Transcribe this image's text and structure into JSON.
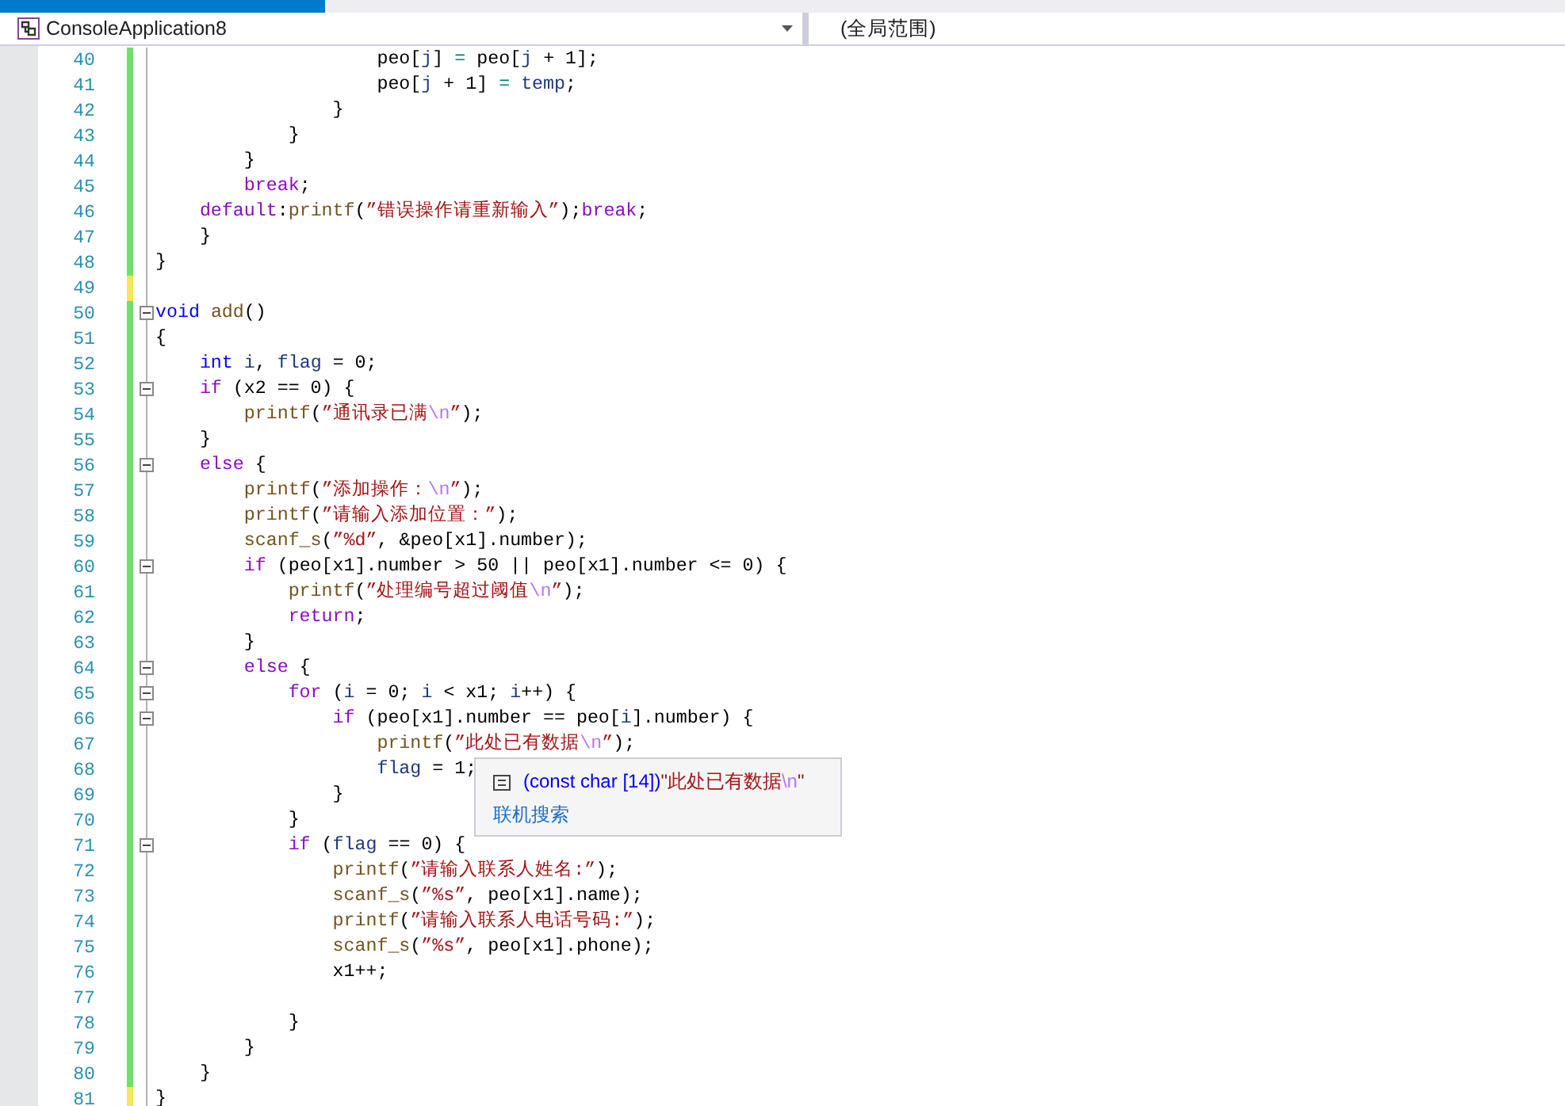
{
  "tab": {
    "shown": true
  },
  "navigation_bar": {
    "project": "ConsoleApplication8",
    "scope": "(全局范围)"
  },
  "editor": {
    "lines": [
      {
        "number": "40",
        "saved": true,
        "foldable": false,
        "tokens": [
          {
            "kind": "plain",
            "text": "                    peo["
          },
          {
            "kind": "variable",
            "text": "j"
          },
          {
            "kind": "plain",
            "text": "] "
          },
          {
            "kind": "operator",
            "text": "="
          },
          {
            "kind": "plain",
            "text": " peo["
          },
          {
            "kind": "variable",
            "text": "j"
          },
          {
            "kind": "plain",
            "text": " + 1];"
          }
        ]
      },
      {
        "number": "41",
        "saved": true,
        "foldable": false,
        "tokens": [
          {
            "kind": "plain",
            "text": "                    peo["
          },
          {
            "kind": "variable",
            "text": "j"
          },
          {
            "kind": "plain",
            "text": " + 1] "
          },
          {
            "kind": "operator",
            "text": "="
          },
          {
            "kind": "variable",
            "text": " temp"
          },
          {
            "kind": "plain",
            "text": ";"
          }
        ]
      },
      {
        "number": "42",
        "saved": true,
        "foldable": false,
        "tokens": [
          {
            "kind": "plain",
            "text": "                }"
          }
        ]
      },
      {
        "number": "43",
        "saved": true,
        "foldable": false,
        "tokens": [
          {
            "kind": "plain",
            "text": "            }"
          }
        ]
      },
      {
        "number": "44",
        "saved": true,
        "foldable": false,
        "tokens": [
          {
            "kind": "plain",
            "text": "        }"
          }
        ]
      },
      {
        "number": "45",
        "saved": true,
        "foldable": false,
        "tokens": [
          {
            "kind": "control",
            "text": "        break"
          },
          {
            "kind": "plain",
            "text": ";"
          }
        ]
      },
      {
        "number": "46",
        "saved": true,
        "foldable": false,
        "tokens": [
          {
            "kind": "control",
            "text": "    default"
          },
          {
            "kind": "plain",
            "text": ":"
          },
          {
            "kind": "function",
            "text": "printf"
          },
          {
            "kind": "plain",
            "text": "("
          },
          {
            "kind": "string",
            "text": "”错误操作请重新输入”"
          },
          {
            "kind": "plain",
            "text": ");"
          },
          {
            "kind": "control",
            "text": "break"
          },
          {
            "kind": "plain",
            "text": ";"
          }
        ]
      },
      {
        "number": "47",
        "saved": true,
        "foldable": false,
        "tokens": [
          {
            "kind": "plain",
            "text": "    }"
          }
        ]
      },
      {
        "number": "48",
        "saved": true,
        "foldable": false,
        "tokens": [
          {
            "kind": "plain",
            "text": "}"
          }
        ]
      },
      {
        "number": "49",
        "saved": false,
        "foldable": false
      },
      {
        "number": "50",
        "saved": true,
        "foldable": true,
        "tokens": [
          {
            "kind": "keyword",
            "text": "void"
          },
          {
            "kind": "function",
            "text": " add"
          },
          {
            "kind": "plain",
            "text": "()"
          }
        ]
      },
      {
        "number": "51",
        "saved": true,
        "foldable": false,
        "tokens": [
          {
            "kind": "plain",
            "text": "{"
          }
        ]
      },
      {
        "number": "52",
        "saved": true,
        "foldable": false,
        "tokens": [
          {
            "kind": "keyword",
            "text": "    int"
          },
          {
            "kind": "variable",
            "text": " i"
          },
          {
            "kind": "plain",
            "text": ", "
          },
          {
            "kind": "variable",
            "text": "flag"
          },
          {
            "kind": "plain",
            "text": " = 0;"
          }
        ]
      },
      {
        "number": "53",
        "saved": true,
        "foldable": true,
        "tokens": [
          {
            "kind": "control",
            "text": "    if"
          },
          {
            "kind": "plain",
            "text": " (x2 == 0) {"
          }
        ]
      },
      {
        "number": "54",
        "saved": true,
        "foldable": false,
        "tokens": [
          {
            "kind": "function",
            "text": "        printf"
          },
          {
            "kind": "plain",
            "text": "("
          },
          {
            "kind": "string",
            "text": "”通讯录已满"
          },
          {
            "kind": "escape",
            "text": "\\n"
          },
          {
            "kind": "string",
            "text": "”"
          },
          {
            "kind": "plain",
            "text": ");"
          }
        ]
      },
      {
        "number": "55",
        "saved": true,
        "foldable": false,
        "tokens": [
          {
            "kind": "plain",
            "text": "    }"
          }
        ]
      },
      {
        "number": "56",
        "saved": true,
        "foldable": true,
        "tokens": [
          {
            "kind": "control",
            "text": "    else"
          },
          {
            "kind": "plain",
            "text": " {"
          }
        ]
      },
      {
        "number": "57",
        "saved": true,
        "foldable": false,
        "tokens": [
          {
            "kind": "function",
            "text": "        printf"
          },
          {
            "kind": "plain",
            "text": "("
          },
          {
            "kind": "string",
            "text": "”添加操作："
          },
          {
            "kind": "escape",
            "text": "\\n"
          },
          {
            "kind": "string",
            "text": "”"
          },
          {
            "kind": "plain",
            "text": ");"
          }
        ]
      },
      {
        "number": "58",
        "saved": true,
        "foldable": false,
        "tokens": [
          {
            "kind": "function",
            "text": "        printf"
          },
          {
            "kind": "plain",
            "text": "("
          },
          {
            "kind": "string",
            "text": "”请输入添加位置：”"
          },
          {
            "kind": "plain",
            "text": ");"
          }
        ]
      },
      {
        "number": "59",
        "saved": true,
        "foldable": false,
        "tokens": [
          {
            "kind": "function",
            "text": "        scanf_s"
          },
          {
            "kind": "plain",
            "text": "("
          },
          {
            "kind": "string",
            "text": "”%d”"
          },
          {
            "kind": "plain",
            "text": ", &peo[x1].number);"
          }
        ]
      },
      {
        "number": "60",
        "saved": true,
        "foldable": true,
        "tokens": [
          {
            "kind": "control",
            "text": "        if"
          },
          {
            "kind": "plain",
            "text": " (peo[x1].number > 50 || peo[x1].number <= 0) {"
          }
        ]
      },
      {
        "number": "61",
        "saved": true,
        "foldable": false,
        "tokens": [
          {
            "kind": "function",
            "text": "            printf"
          },
          {
            "kind": "plain",
            "text": "("
          },
          {
            "kind": "string",
            "text": "”处理编号超过阈值"
          },
          {
            "kind": "escape",
            "text": "\\n"
          },
          {
            "kind": "string",
            "text": "”"
          },
          {
            "kind": "plain",
            "text": ");"
          }
        ]
      },
      {
        "number": "62",
        "saved": true,
        "foldable": false,
        "tokens": [
          {
            "kind": "control",
            "text": "            return"
          },
          {
            "kind": "plain",
            "text": ";"
          }
        ]
      },
      {
        "number": "63",
        "saved": true,
        "foldable": false,
        "tokens": [
          {
            "kind": "plain",
            "text": "        }"
          }
        ]
      },
      {
        "number": "64",
        "saved": true,
        "foldable": true,
        "tokens": [
          {
            "kind": "control",
            "text": "        else"
          },
          {
            "kind": "plain",
            "text": " {"
          }
        ]
      },
      {
        "number": "65",
        "saved": true,
        "foldable": true,
        "tokens": [
          {
            "kind": "control",
            "text": "            for"
          },
          {
            "kind": "plain",
            "text": " ("
          },
          {
            "kind": "variable",
            "text": "i"
          },
          {
            "kind": "plain",
            "text": " = 0; "
          },
          {
            "kind": "variable",
            "text": "i"
          },
          {
            "kind": "plain",
            "text": " < x1; "
          },
          {
            "kind": "variable",
            "text": "i"
          },
          {
            "kind": "plain",
            "text": "++) {"
          }
        ]
      },
      {
        "number": "66",
        "saved": true,
        "foldable": true,
        "tokens": [
          {
            "kind": "control",
            "text": "                if"
          },
          {
            "kind": "plain",
            "text": " (peo[x1].number == peo["
          },
          {
            "kind": "variable",
            "text": "i"
          },
          {
            "kind": "plain",
            "text": "].number) {"
          }
        ]
      },
      {
        "number": "67",
        "saved": true,
        "foldable": false,
        "tokens": [
          {
            "kind": "function",
            "text": "                    printf"
          },
          {
            "kind": "plain",
            "text": "("
          },
          {
            "kind": "string",
            "text": "”此处已有数据"
          },
          {
            "kind": "escape",
            "text": "\\n"
          },
          {
            "kind": "string",
            "text": "”"
          },
          {
            "kind": "plain",
            "text": ");"
          }
        ]
      },
      {
        "number": "68",
        "saved": true,
        "foldable": false,
        "tokens": [
          {
            "kind": "variable",
            "text": "                    flag"
          },
          {
            "kind": "plain",
            "text": " = 1;"
          }
        ]
      },
      {
        "number": "69",
        "saved": true,
        "foldable": false,
        "tokens": [
          {
            "kind": "plain",
            "text": "                }"
          }
        ]
      },
      {
        "number": "70",
        "saved": true,
        "foldable": false,
        "tokens": [
          {
            "kind": "plain",
            "text": "            }"
          }
        ]
      },
      {
        "number": "71",
        "saved": true,
        "foldable": true,
        "tokens": [
          {
            "kind": "control",
            "text": "            if"
          },
          {
            "kind": "plain",
            "text": " ("
          },
          {
            "kind": "variable",
            "text": "flag"
          },
          {
            "kind": "plain",
            "text": " == 0) {"
          }
        ]
      },
      {
        "number": "72",
        "saved": true,
        "foldable": false,
        "tokens": [
          {
            "kind": "function",
            "text": "                printf"
          },
          {
            "kind": "plain",
            "text": "("
          },
          {
            "kind": "string",
            "text": "”请输入联系人姓名:”"
          },
          {
            "kind": "plain",
            "text": ");"
          }
        ]
      },
      {
        "number": "73",
        "saved": true,
        "foldable": false,
        "tokens": [
          {
            "kind": "function",
            "text": "                scanf_s"
          },
          {
            "kind": "plain",
            "text": "("
          },
          {
            "kind": "string",
            "text": "”%s”"
          },
          {
            "kind": "plain",
            "text": ", peo[x1].name);"
          }
        ]
      },
      {
        "number": "74",
        "saved": true,
        "foldable": false,
        "tokens": [
          {
            "kind": "function",
            "text": "                printf"
          },
          {
            "kind": "plain",
            "text": "("
          },
          {
            "kind": "string",
            "text": "”请输入联系人电话号码:”"
          },
          {
            "kind": "plain",
            "text": ");"
          }
        ]
      },
      {
        "number": "75",
        "saved": true,
        "foldable": false,
        "tokens": [
          {
            "kind": "function",
            "text": "                scanf_s"
          },
          {
            "kind": "plain",
            "text": "("
          },
          {
            "kind": "string",
            "text": "”%s”"
          },
          {
            "kind": "plain",
            "text": ", peo[x1].phone);"
          }
        ]
      },
      {
        "number": "76",
        "saved": true,
        "foldable": false,
        "tokens": [
          {
            "kind": "plain",
            "text": "                x1++;"
          }
        ]
      },
      {
        "number": "77",
        "saved": true,
        "foldable": false
      },
      {
        "number": "78",
        "saved": true,
        "foldable": false,
        "tokens": [
          {
            "kind": "plain",
            "text": "            }"
          }
        ]
      },
      {
        "number": "79",
        "saved": true,
        "foldable": false,
        "tokens": [
          {
            "kind": "plain",
            "text": "        }"
          }
        ]
      },
      {
        "number": "80",
        "saved": true,
        "foldable": false,
        "tokens": [
          {
            "kind": "plain",
            "text": "    }"
          }
        ]
      },
      {
        "number": "81",
        "saved": false,
        "foldable": false,
        "tokens": [
          {
            "kind": "plain",
            "text": "}"
          }
        ]
      }
    ]
  },
  "tooltip": {
    "signature": [
      {
        "kind": "type",
        "text": "(const char [14])"
      },
      {
        "kind": "string",
        "text": "\"此处已有数据"
      },
      {
        "kind": "escape",
        "text": "\\n"
      },
      {
        "kind": "string",
        "text": "\""
      }
    ],
    "link": "联机搜索"
  }
}
